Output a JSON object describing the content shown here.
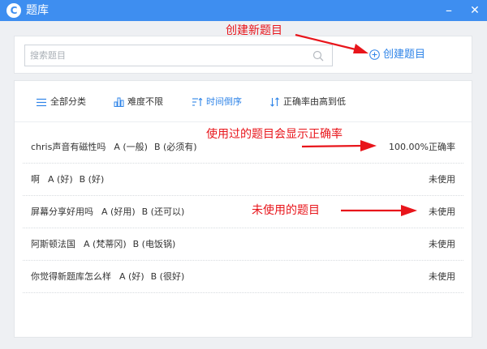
{
  "window": {
    "title": "题库",
    "logo_letter": "C",
    "minimize": "–",
    "close": "✕",
    "accent": "#3e8ef0"
  },
  "search": {
    "placeholder": "搜索题目",
    "value": ""
  },
  "create_button": {
    "label": "创建题目"
  },
  "filters": {
    "category": "全部分类",
    "difficulty": "难度不限",
    "time_order": "时间倒序",
    "accuracy_order": "正确率由高到低"
  },
  "questions": [
    {
      "text": "chris声音有磁性吗",
      "options": [
        "A (一般)",
        "B (必须有)"
      ],
      "status": "100.00%正确率"
    },
    {
      "text": "啊",
      "options": [
        "A (好)",
        "B (好)"
      ],
      "status": "未使用"
    },
    {
      "text": "屏幕分享好用吗",
      "options": [
        "A (好用)",
        "B (还可以)"
      ],
      "status": "未使用"
    },
    {
      "text": "阿斯顿法国",
      "options": [
        "A (梵蒂冈)",
        "B (电饭锅)"
      ],
      "status": "未使用"
    },
    {
      "text": "你觉得新题库怎么样",
      "options": [
        "A (好)",
        "B (很好)"
      ],
      "status": "未使用"
    }
  ],
  "annotations": {
    "create": "创建新题目",
    "used": "使用过的题目会显示正确率",
    "unused": "未使用的题目",
    "color": "#e8151b"
  }
}
